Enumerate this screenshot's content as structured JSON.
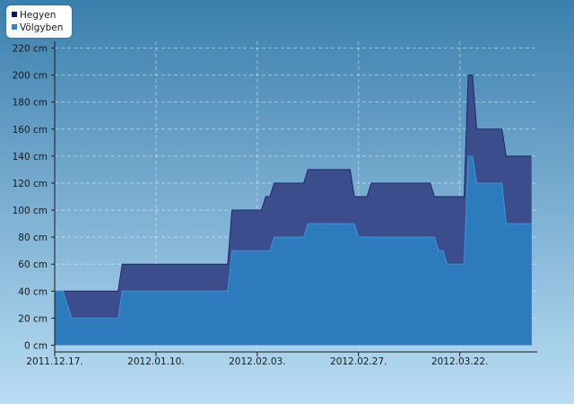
{
  "colors": {
    "background_top": "#3b7fae",
    "background_bottom": "#b9ddf3",
    "hegyen": "#3b4d8d",
    "hegyen_line": "#1d2a66",
    "volgyben": "#2d7bbd",
    "volgyben_line": "#3a95d6",
    "legend_hegyen": "#101466",
    "legend_volgyben": "#2a8ad0"
  },
  "legend": [
    {
      "label": "Hegyen",
      "color": "#101466"
    },
    {
      "label": "Völgyben",
      "color": "#2a8ad0"
    }
  ],
  "chart_data": {
    "type": "area",
    "x_tick_labels": [
      "2011.12.17.",
      "2012.01.10.",
      "2012.02.03.",
      "2012.02.27.",
      "2012.03.22."
    ],
    "x_tick_dates": [
      "2011-12-17",
      "2012-01-10",
      "2012-02-03",
      "2012-02-27",
      "2012-03-22"
    ],
    "x_range": [
      "2011-12-17",
      "2012-04-08"
    ],
    "y_ticks": [
      0,
      20,
      40,
      60,
      80,
      100,
      120,
      140,
      160,
      180,
      200,
      220
    ],
    "y_unit": "cm",
    "ylim": [
      -5,
      225
    ],
    "grid": true,
    "legend_position": "top-left",
    "series": [
      {
        "name": "Hegyen",
        "points": [
          [
            "2011-12-17",
            40
          ],
          [
            "2012-01-01",
            40
          ],
          [
            "2012-01-02",
            60
          ],
          [
            "2012-01-27",
            60
          ],
          [
            "2012-01-28",
            100
          ],
          [
            "2012-02-04",
            100
          ],
          [
            "2012-02-05",
            110
          ],
          [
            "2012-02-06",
            110
          ],
          [
            "2012-02-07",
            120
          ],
          [
            "2012-02-14",
            120
          ],
          [
            "2012-02-15",
            130
          ],
          [
            "2012-02-25",
            130
          ],
          [
            "2012-02-26",
            110
          ],
          [
            "2012-02-29",
            110
          ],
          [
            "2012-03-01",
            120
          ],
          [
            "2012-03-15",
            120
          ],
          [
            "2012-03-16",
            110
          ],
          [
            "2012-03-23",
            110
          ],
          [
            "2012-03-24",
            200
          ],
          [
            "2012-03-25",
            200
          ],
          [
            "2012-03-26",
            160
          ],
          [
            "2012-04-01",
            160
          ],
          [
            "2012-04-02",
            140
          ],
          [
            "2012-04-08",
            140
          ]
        ]
      },
      {
        "name": "Völgyben",
        "points": [
          [
            "2011-12-17",
            40
          ],
          [
            "2011-12-19",
            40
          ],
          [
            "2011-12-20",
            30
          ],
          [
            "2011-12-21",
            20
          ],
          [
            "2012-01-01",
            20
          ],
          [
            "2012-01-02",
            40
          ],
          [
            "2012-01-27",
            40
          ],
          [
            "2012-01-28",
            70
          ],
          [
            "2012-02-06",
            70
          ],
          [
            "2012-02-07",
            80
          ],
          [
            "2012-02-14",
            80
          ],
          [
            "2012-02-15",
            90
          ],
          [
            "2012-02-26",
            90
          ],
          [
            "2012-02-27",
            80
          ],
          [
            "2012-03-16",
            80
          ],
          [
            "2012-03-17",
            70
          ],
          [
            "2012-03-18",
            70
          ],
          [
            "2012-03-19",
            60
          ],
          [
            "2012-03-23",
            60
          ],
          [
            "2012-03-24",
            140
          ],
          [
            "2012-03-25",
            140
          ],
          [
            "2012-03-26",
            120
          ],
          [
            "2012-04-01",
            120
          ],
          [
            "2012-04-02",
            90
          ],
          [
            "2012-04-08",
            90
          ]
        ]
      }
    ]
  }
}
